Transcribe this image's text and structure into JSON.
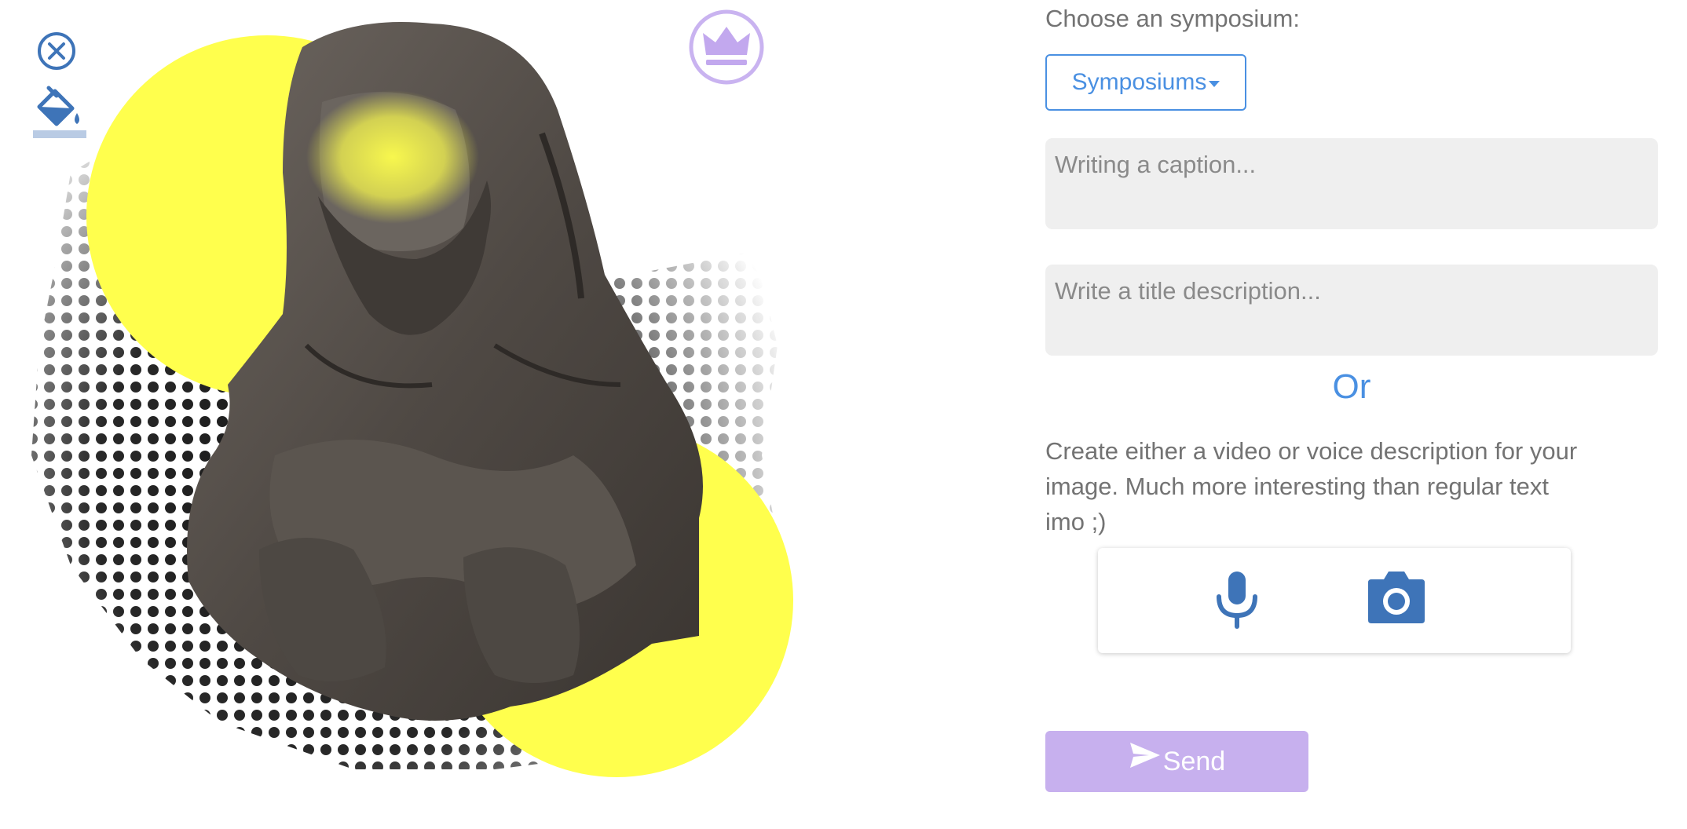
{
  "editor": {
    "close_icon": "close-circle-icon",
    "paint_icon": "paint-bucket-icon",
    "premium_icon": "crown-icon",
    "artwork_alt": "bust-statue-collage"
  },
  "form": {
    "choose_label": "Choose an symposium:",
    "symposium_dropdown_label": "Symposiums",
    "caption_placeholder": "Writing a caption...",
    "title_placeholder": "Write a title description...",
    "or_label": "Or",
    "media_description": "Create either a video or voice description for your image. Much more interesting than regular text imo ;)",
    "mic_icon": "microphone-icon",
    "camera_icon": "camera-icon",
    "send_label": "Send",
    "send_icon": "paper-plane-icon"
  },
  "colors": {
    "accent_blue": "#4a90e2",
    "icon_blue": "#3e74b8",
    "send_purple": "#c7b0ee",
    "highlight_yellow": "#ffff4d"
  }
}
